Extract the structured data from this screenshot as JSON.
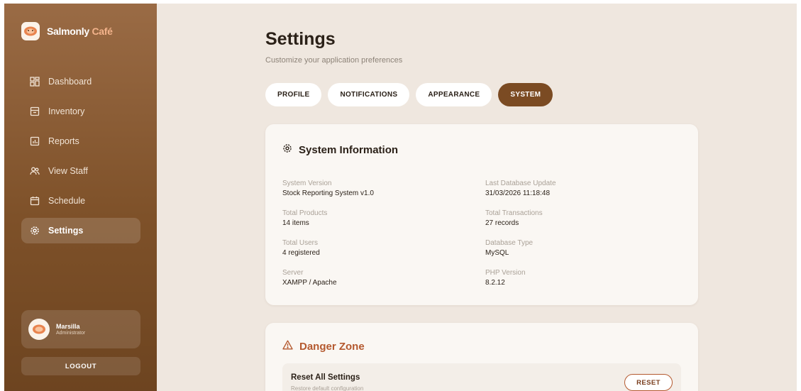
{
  "brand": {
    "name": "Salmonly",
    "accent_name": "Café"
  },
  "sidebar": {
    "items": [
      {
        "label": "Dashboard",
        "icon": "dashboard-icon"
      },
      {
        "label": "Inventory",
        "icon": "inventory-icon"
      },
      {
        "label": "Reports",
        "icon": "reports-icon"
      },
      {
        "label": "View Staff",
        "icon": "staff-icon"
      },
      {
        "label": "Schedule",
        "icon": "calendar-icon"
      },
      {
        "label": "Settings",
        "icon": "gear-icon",
        "active": true
      }
    ],
    "user": {
      "name": "Marsilla",
      "role": "Administrator"
    },
    "logout_label": "LOGOUT"
  },
  "page": {
    "title": "Settings",
    "subtitle": "Customize your application preferences"
  },
  "tabs": [
    {
      "label": "PROFILE"
    },
    {
      "label": "NOTIFICATIONS"
    },
    {
      "label": "APPEARANCE"
    },
    {
      "label": "SYSTEM",
      "active": true
    }
  ],
  "system_info": {
    "heading": "System Information",
    "left": [
      {
        "label": "System Version",
        "value": "Stock Reporting System v1.0"
      },
      {
        "label": "Total Products",
        "value": "14 items"
      },
      {
        "label": "Total Users",
        "value": "4 registered"
      },
      {
        "label": "Server",
        "value": "XAMPP / Apache"
      }
    ],
    "right": [
      {
        "label": "Last Database Update",
        "value": "31/03/2026 11:18:48"
      },
      {
        "label": "Total Transactions",
        "value": "27 records"
      },
      {
        "label": "Database Type",
        "value": "MySQL"
      },
      {
        "label": "PHP Version",
        "value": "8.2.12"
      }
    ]
  },
  "danger_zone": {
    "heading": "Danger Zone",
    "reset_title": "Reset All Settings",
    "reset_desc": "Restore default configuration",
    "reset_button": "RESET"
  },
  "colors": {
    "sidebar_top": "#9a6b45",
    "sidebar_bottom": "#6d4420",
    "accent": "#7b4b23",
    "danger": "#b4592f",
    "background": "#efe7df",
    "card": "#faf7f3"
  }
}
